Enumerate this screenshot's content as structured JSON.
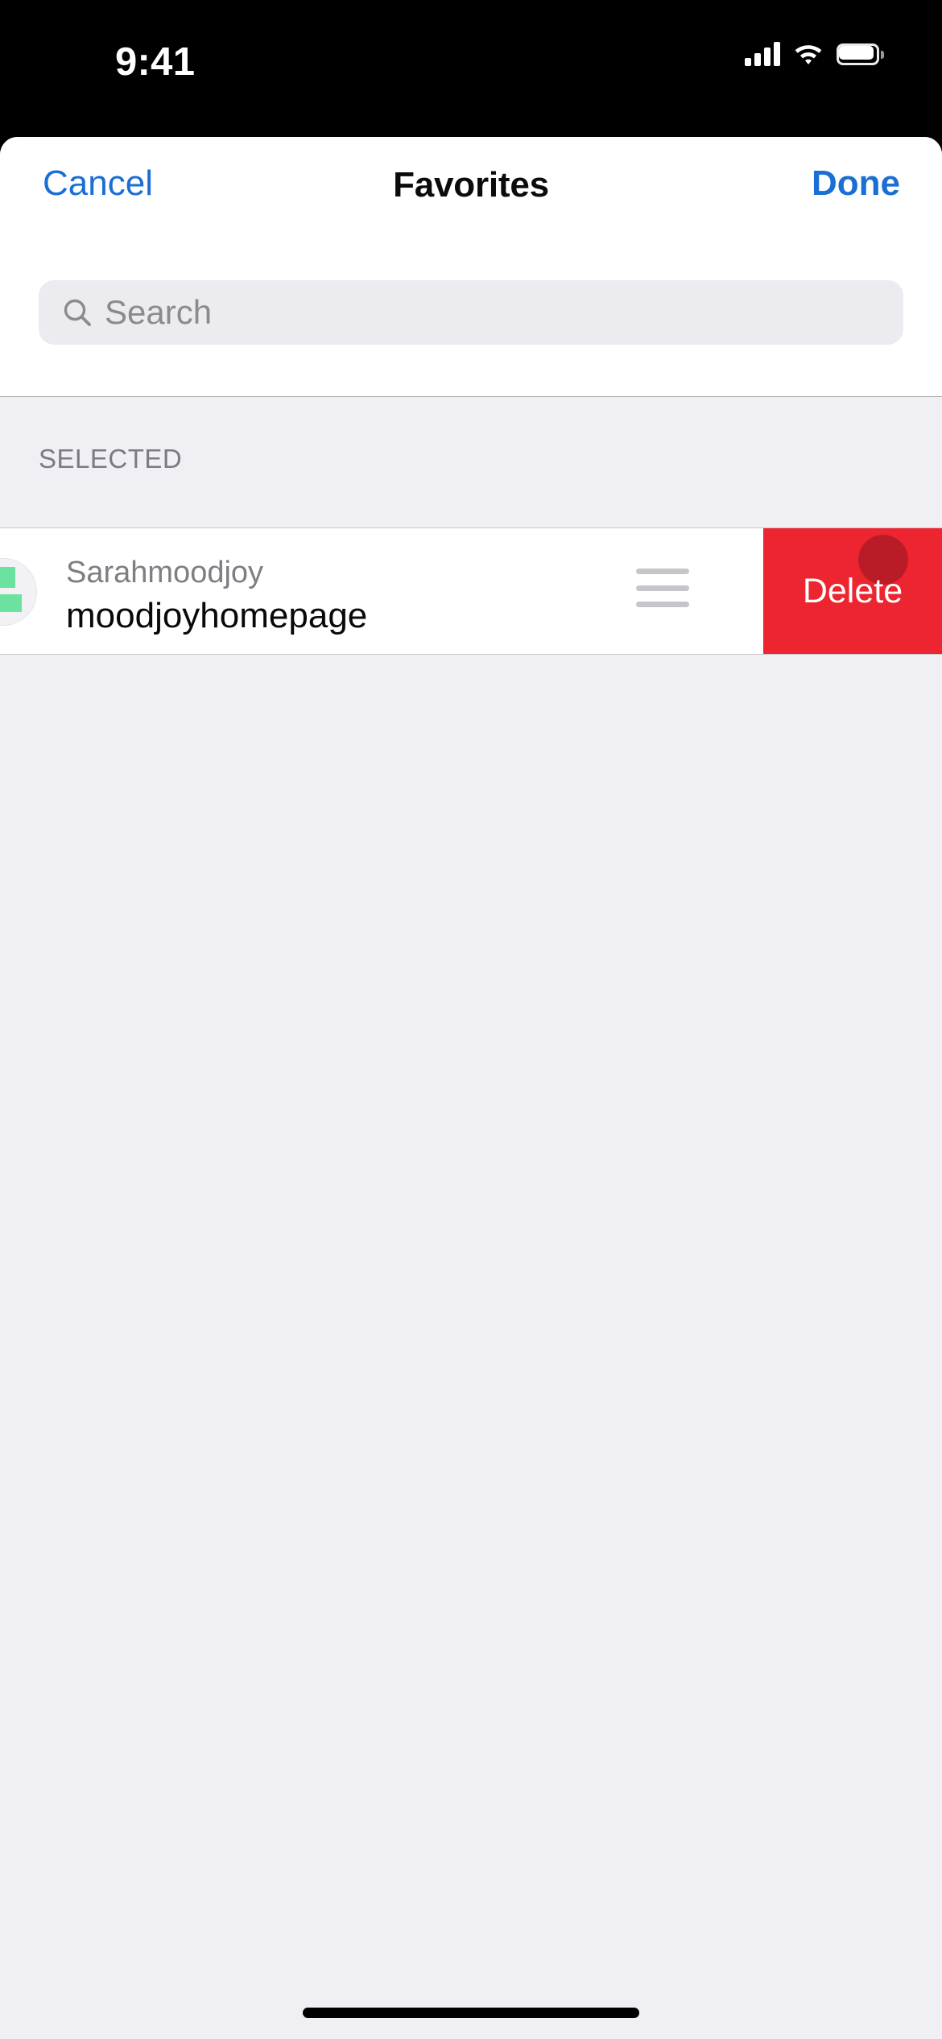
{
  "status_bar": {
    "time": "9:41",
    "cellular_icon": "cellular-bars-icon",
    "wifi_icon": "wifi-icon",
    "battery_icon": "battery-full-icon"
  },
  "sheet": {
    "nav": {
      "cancel_label": "Cancel",
      "title": "Favorites",
      "done_label": "Done"
    },
    "search": {
      "placeholder": "Search",
      "value": "",
      "icon": "search-icon"
    },
    "sections": [
      {
        "header": "SELECTED",
        "rows": [
          {
            "title": "Sarahmoodjoy",
            "subtitle": "moodjoyhomepage",
            "avatar_icon": "avatar-image",
            "reorder_icon": "reorder-handle-icon",
            "swipe_action": {
              "label": "Delete",
              "color": "#ed2531"
            }
          }
        ]
      }
    ]
  },
  "colors": {
    "accent_blue": "#1a6fd4",
    "destructive_red": "#ed2531",
    "background_gray": "#f0eff4",
    "row_white": "#ffffff",
    "search_field_gray": "#ececf0",
    "secondary_text": "#7e7e84"
  },
  "home_indicator": "home-indicator"
}
